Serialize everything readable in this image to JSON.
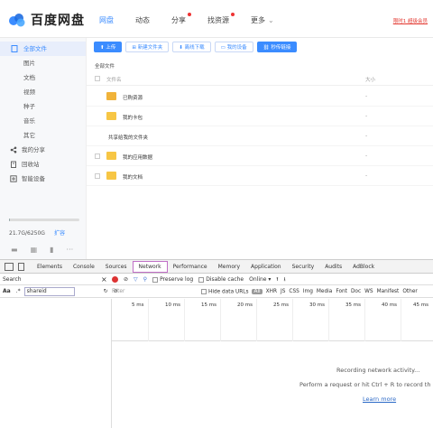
{
  "header": {
    "logo_text": "百度网盘",
    "nav": [
      {
        "label": "网盘"
      },
      {
        "label": "动态"
      },
      {
        "label": "分享"
      },
      {
        "label": "找资源"
      },
      {
        "label": "更多"
      }
    ],
    "promo": "限时1 超级会员"
  },
  "sidebar": {
    "all_files": "全部文件",
    "items": [
      {
        "label": "图片"
      },
      {
        "label": "文档"
      },
      {
        "label": "视频"
      },
      {
        "label": "种子"
      },
      {
        "label": "音乐"
      },
      {
        "label": "其它"
      }
    ],
    "share": "我的分享",
    "recycle": "回收站",
    "devices": "智能设备",
    "quota": "21.7G/6250G",
    "quota_fraction": 0.0035,
    "expand": "扩容"
  },
  "toolbar": {
    "upload": "上传",
    "new_folder": "新建文件夹",
    "offline": "离线下载",
    "my_device": "我的设备",
    "secret": "秒传链接"
  },
  "breadcrumb": "全部文件",
  "table": {
    "col_name": "文件名",
    "col_size": "大小",
    "rows": [
      {
        "name": "已购资源",
        "size": "-",
        "icon": "folder-cart-icon"
      },
      {
        "name": "我的卡包",
        "size": "-",
        "icon": "folder-icon"
      },
      {
        "name": "共享给我的文件夹",
        "size": "-",
        "icon": "none"
      },
      {
        "name": "我的应用数据",
        "size": "-",
        "icon": "folder-icon"
      },
      {
        "name": "我的文档",
        "size": "-",
        "icon": "folder-icon"
      }
    ]
  },
  "devtools": {
    "tabs": [
      "Elements",
      "Console",
      "Sources",
      "Network",
      "Performance",
      "Memory",
      "Application",
      "Security",
      "Audits",
      "AdBlock"
    ],
    "active_tab": "Network",
    "search_label": "Search",
    "search_value": "shareid",
    "aa": "Aa",
    "regex": ".*",
    "preserve_log": "Preserve log",
    "disable_cache": "Disable cache",
    "online": "Online",
    "filter_placeholder": "Filter",
    "hide_data_urls": "Hide data URLs",
    "all": "All",
    "types": [
      "XHR",
      "JS",
      "CSS",
      "Img",
      "Media",
      "Font",
      "Doc",
      "WS",
      "Manifest",
      "Other"
    ],
    "ticks": [
      "5 ms",
      "10 ms",
      "15 ms",
      "20 ms",
      "25 ms",
      "30 ms",
      "35 ms",
      "40 ms",
      "45 ms"
    ],
    "empty_line1": "Recording network activity...",
    "empty_line2": "Perform a request or hit Ctrl + R to record th",
    "learn_more": "Learn more"
  }
}
